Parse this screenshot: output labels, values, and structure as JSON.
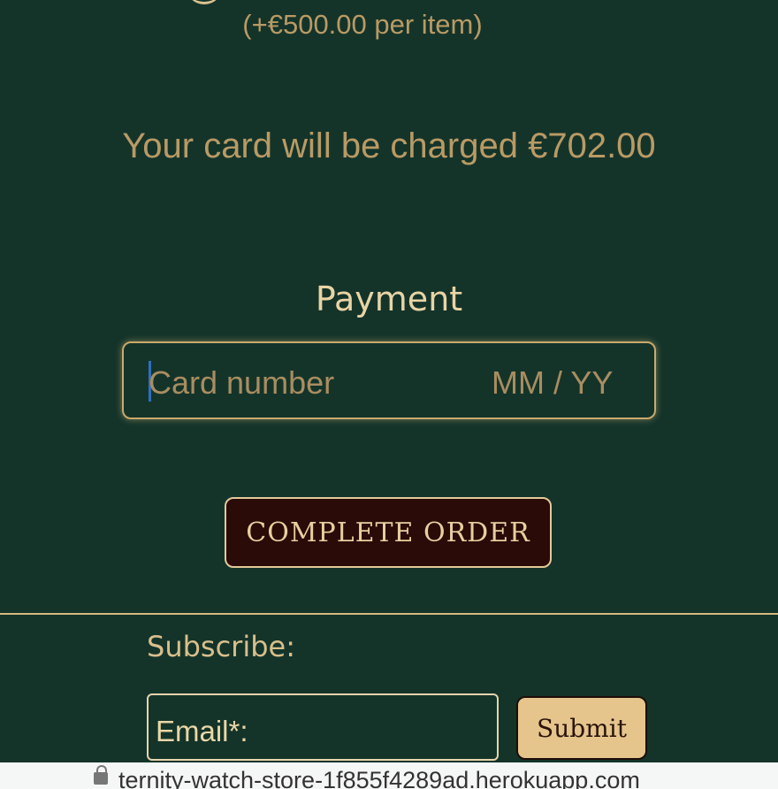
{
  "order": {
    "per_item_text": "(+€500.00 per item)",
    "charge_text": "Your card will be charged €702.00"
  },
  "payment": {
    "title": "Payment",
    "card_number_placeholder": "Card number",
    "expiry_placeholder": "MM / YY",
    "complete_button": "COMPLETE ORDER"
  },
  "footer": {
    "subscribe_label": "Subscribe:",
    "email_placeholder": "Email*:",
    "submit_button": "Submit"
  },
  "browser": {
    "url_text": "ternity-watch-store-1f855f4289ad.herokuapp.com",
    "lock_icon": "lock-icon"
  }
}
